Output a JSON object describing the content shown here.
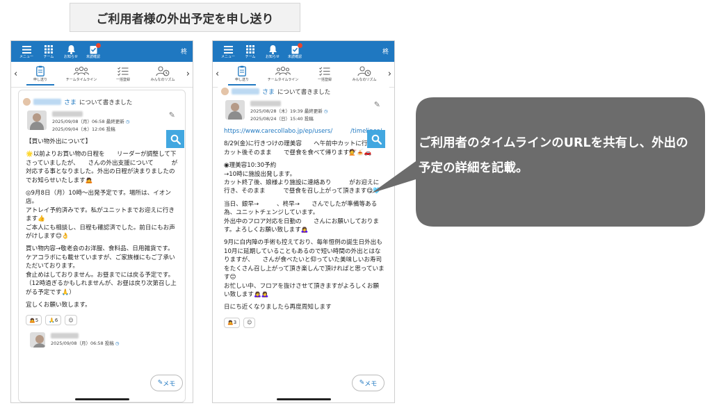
{
  "heading": "ご利用者様の外出予定を申し送り",
  "topbar": {
    "items": [
      {
        "icon": "menu-icon",
        "label": "メニュー"
      },
      {
        "icon": "grid-icon",
        "label": "チーム"
      },
      {
        "icon": "bell-icon",
        "label": "お知らせ"
      },
      {
        "icon": "clipboard-check-icon",
        "label": "未読確認"
      }
    ],
    "user_initial": "柊"
  },
  "tabs": [
    {
      "icon": "clipboard-icon",
      "label": "申し送り"
    },
    {
      "icon": "team-icon",
      "label": "チームタイムライン"
    },
    {
      "icon": "checklist-icon",
      "label": "一括登録"
    },
    {
      "icon": "people-rhythm-icon",
      "label": "みんなのリズム"
    }
  ],
  "left_post": {
    "about_suffix": "さま",
    "about_text": "について書きました",
    "meta_updated": "2025/09/08（月）06:58 最終更新",
    "meta_posted": "2025/09/04（木）12:06 投稿",
    "paragraphs": [
      "【買い物外出について】",
      "🌟以前よりお買い物の日程を　　リーダーが調整して下さっていましたが、　　さんの外出支援について　　　が対応する事となりました。外出の日程が決まりましたのでお知らせいたします🙇",
      "◎9月8日（月）10時〜出発予定です。場所は、イオン　　店。\nアトレイ予約済みです。私がユニットまでお迎えに行きます👍\nご本人にも相談し、日程も確認済でした。前日にもお声がけします😊👌",
      "買い物内容→敬老会のお洋服、食料品、日用雑貨です。ケアコラボにも載せていますが、ご家族様にもご了承いただいております。\n食止めはしておりません。お昼までには戻る予定です。（12時過ぎるかもしれませんが、お昼は戻り次第召し上がる予定です🙏）",
      "宜しくお願い致します。"
    ],
    "reactions": [
      "🙇5",
      "🙏6",
      "☺"
    ],
    "second_meta": "2025/09/08（月）06:58 投稿"
  },
  "right_post": {
    "about_suffix": "さま",
    "about_text": "について書きました",
    "meta_updated": "2025/08/28（木）19:39 最終更新",
    "meta_posted": "2025/08/24（日）15:40 投稿",
    "link_text": "https://www.carecollabo.jp/ep/users/　　　/timelines/　　　",
    "paragraphs": [
      "8/29(金)に行きつけの理美容　　へ午前中カットに行き、カット後そのまま　　で昼食を食べて帰ります💇🍝🚗",
      "◉理美容10:30予約\n→10時に施設出発します。\nカット終了後、娘様より施設に連絡あり　　　がお迎えに行き、そのまま　　　で昼食を召し上がって頂きます😋🩵",
      "当日、銀早→　　　、柊早→　　さんでしたが準備等ある為、ユニットチェンジしています。\n外出中のフロア対応を日勤の　　さんにお願いしております。よろしくお願い致します🙇‍♀️",
      "9月に白内障の手術も控えており、毎年恒例の誕生日外出も10月に延期していることもあるので短い時間の外出とはなりますが、　　さんが食べたいと仰っていた美味しいお寿司をたくさん召し上がって頂き楽しんで頂ければと思っています😊\nお忙しい中、フロアを抜けさせて頂きますがよろしくお願い致します🙇‍♀️🙇‍♀️",
      "日にち近くなりましたら再度周知します"
    ],
    "reactions": [
      "🙇3",
      "☺"
    ]
  },
  "memo_label": "メモ",
  "callout_text": "ご利用者のタイムラインのURLを共有し、外出の予定の詳細を記載。",
  "colors": {
    "header_blue": "#1f78c1",
    "search_blue": "#42a7e0",
    "callout_gray": "#6c6c6c",
    "badge_red": "#e8452c"
  }
}
